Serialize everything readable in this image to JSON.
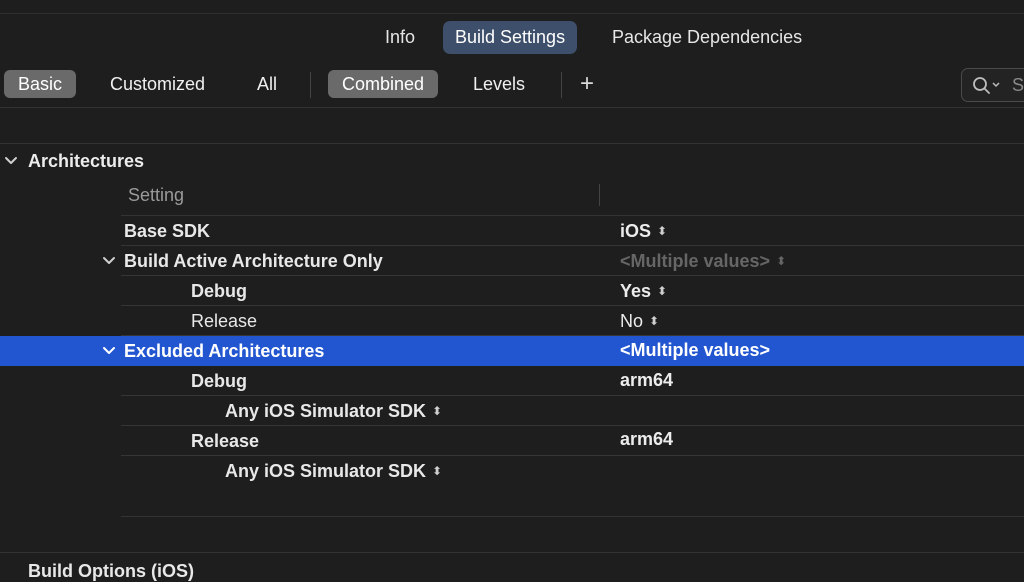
{
  "tabs": [
    {
      "label": "Info"
    },
    {
      "label": "Build Settings"
    },
    {
      "label": "Package Dependencies"
    }
  ],
  "filters": {
    "basic": "Basic",
    "customized": "Customized",
    "all": "All",
    "combined": "Combined",
    "levels": "Levels",
    "add": "+",
    "search_placeholder": "S"
  },
  "section": {
    "title": "Architectures",
    "column_header": "Setting"
  },
  "rows": [
    {
      "label": "Base SDK",
      "value": "iOS"
    },
    {
      "label": "Build Active Architecture Only",
      "value": "<Multiple values>"
    },
    {
      "label": "Debug",
      "value": "Yes"
    },
    {
      "label": "Release",
      "value": "No"
    },
    {
      "label": "Excluded Architectures",
      "value": "<Multiple values>"
    },
    {
      "label": "Debug",
      "value": "arm64"
    },
    {
      "label": "Any iOS Simulator SDK",
      "value": ""
    },
    {
      "label": "Release",
      "value": "arm64"
    },
    {
      "label": "Any iOS Simulator SDK",
      "value": ""
    }
  ],
  "next_section": {
    "title": "Build Options (iOS)"
  },
  "colors": {
    "selection": "#2256d1",
    "active_tab": "#3d4f6a",
    "background": "#1e1e1e"
  }
}
